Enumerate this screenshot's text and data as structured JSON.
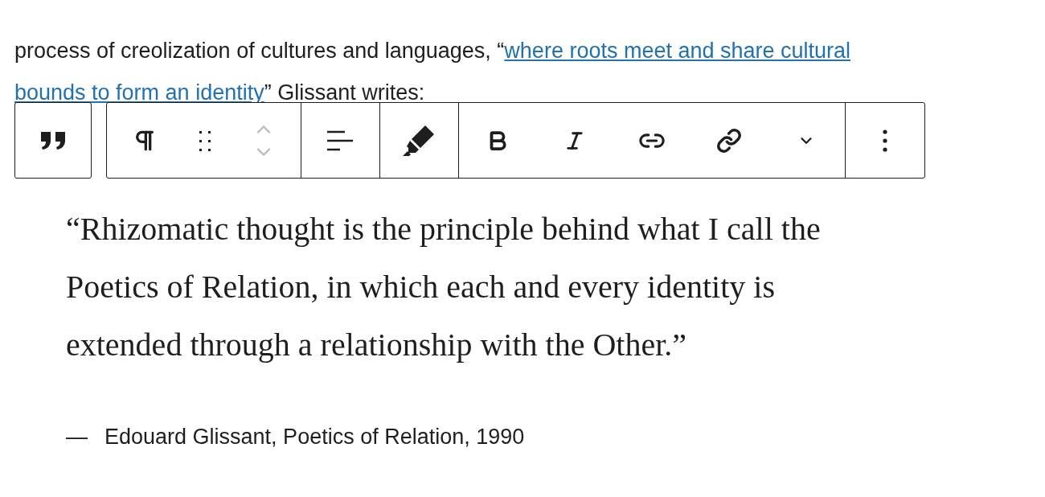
{
  "paragraph": {
    "text_before": "process of creolization of cultures and languages, “",
    "link_lines": [
      "where roots meet and share cultural",
      "bounds to form an identity"
    ],
    "text_after": "” Glissant writes:"
  },
  "quote": {
    "text": "“Rhizomatic thought is the principle behind what I call the Poetics of Relation, in which each and every identity is extended through a relationship with the Other.”",
    "dash": "—",
    "citation": "Edouard Glissant, Poetics of Relation, 1990"
  }
}
